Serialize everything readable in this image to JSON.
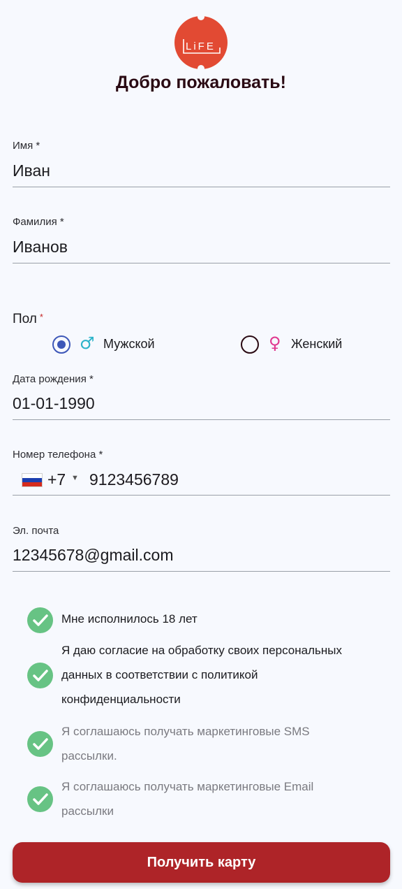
{
  "logo": {
    "text": "LiFE",
    "color": "#e24a33"
  },
  "title": "Добро пожаловать!",
  "first_name": {
    "label": "Имя *",
    "value": "Иван"
  },
  "last_name": {
    "label": "Фамилия *",
    "value": "Иванов"
  },
  "gender": {
    "label": "Пол",
    "required_mark": "*",
    "male": {
      "icon": "♂",
      "label": "Мужской",
      "selected": true
    },
    "female": {
      "icon": "♀",
      "label": "Женский",
      "selected": false
    }
  },
  "birth_date": {
    "label": "Дата рождения *",
    "value": "01-01-1990"
  },
  "phone": {
    "label": "Номер телефона *",
    "country_code": "+7",
    "caret": "▼",
    "value": "9123456789",
    "flag": "russia-flag"
  },
  "email": {
    "label": "Эл. почта",
    "value": "12345678@gmail.com"
  },
  "consents": [
    {
      "text": "Мне исполнилось 18 лет",
      "checked": true
    },
    {
      "text": "Я даю согласие на обработку своих персональных данных в соответствии с политикой конфиденциальности",
      "checked": true
    },
    {
      "text": "Я соглашаюсь получать маркетинговые SMS рассылки.",
      "checked": true
    },
    {
      "text": "Я соглашаюсь получать маркетинговые Email рассылки",
      "checked": true
    }
  ],
  "submit_label": "Получить карту",
  "colors": {
    "accent": "#ae2428",
    "check": "#67c384",
    "radio": "#3d57b8",
    "male_icon": "#2bb3c9",
    "female_icon": "#e0388f"
  }
}
